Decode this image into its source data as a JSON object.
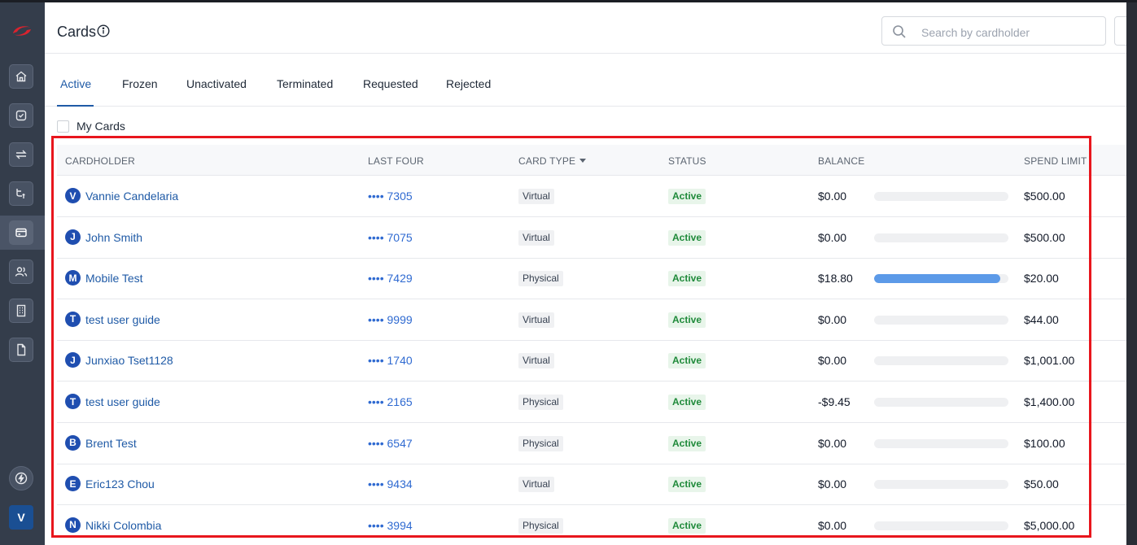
{
  "app": {
    "title": "Cards",
    "avatar_initial": "V",
    "colors": {
      "accent": "#1f5aa6",
      "highlight": "#e8161d",
      "active_green": "#1f8a3a",
      "bar_fill": "#5c9ae8"
    }
  },
  "sidebar": {
    "items": [
      {
        "name": "home-icon"
      },
      {
        "name": "tasks-icon"
      },
      {
        "name": "transfers-icon"
      },
      {
        "name": "routing-icon"
      },
      {
        "name": "cards-icon",
        "selected": true
      },
      {
        "name": "people-icon"
      },
      {
        "name": "building-icon"
      },
      {
        "name": "document-icon"
      }
    ],
    "bottom": [
      {
        "name": "lightning-icon"
      }
    ]
  },
  "search": {
    "placeholder": "Search by cardholder"
  },
  "tabs": [
    "Active",
    "Frozen",
    "Unactivated",
    "Terminated",
    "Requested",
    "Rejected"
  ],
  "active_tab": "Active",
  "filter": {
    "my_cards_label": "My Cards",
    "checked": false
  },
  "table": {
    "headers": {
      "cardholder": "CARDHOLDER",
      "last_four": "LAST FOUR",
      "card_type": "CARD TYPE",
      "status": "STATUS",
      "balance": "BALANCE",
      "spend_limit": "SPEND LIMIT"
    },
    "rows": [
      {
        "initial": "V",
        "name": "Vannie Candelaria",
        "last4": "•••• 7305",
        "type": "Virtual",
        "status": "Active",
        "balance": "$0.00",
        "progress": 0,
        "limit": "$500.00"
      },
      {
        "initial": "J",
        "name": "John Smith",
        "last4": "•••• 7075",
        "type": "Virtual",
        "status": "Active",
        "balance": "$0.00",
        "progress": 0,
        "limit": "$500.00"
      },
      {
        "initial": "M",
        "name": "Mobile Test",
        "last4": "•••• 7429",
        "type": "Physical",
        "status": "Active",
        "balance": "$18.80",
        "progress": 0.94,
        "limit": "$20.00"
      },
      {
        "initial": "T",
        "name": "test user guide",
        "last4": "•••• 9999",
        "type": "Virtual",
        "status": "Active",
        "balance": "$0.00",
        "progress": 0,
        "limit": "$44.00"
      },
      {
        "initial": "J",
        "name": "Junxiao Tset1128",
        "last4": "•••• 1740",
        "type": "Virtual",
        "status": "Active",
        "balance": "$0.00",
        "progress": 0,
        "limit": "$1,001.00"
      },
      {
        "initial": "T",
        "name": "test user guide",
        "last4": "•••• 2165",
        "type": "Physical",
        "status": "Active",
        "balance": "-$9.45",
        "progress": 0,
        "limit": "$1,400.00"
      },
      {
        "initial": "B",
        "name": "Brent Test",
        "last4": "•••• 6547",
        "type": "Physical",
        "status": "Active",
        "balance": "$0.00",
        "progress": 0,
        "limit": "$100.00"
      },
      {
        "initial": "E",
        "name": "Eric123 Chou",
        "last4": "•••• 9434",
        "type": "Virtual",
        "status": "Active",
        "balance": "$0.00",
        "progress": 0,
        "limit": "$50.00"
      },
      {
        "initial": "N",
        "name": "Nikki Colombia",
        "last4": "•••• 3994",
        "type": "Physical",
        "status": "Active",
        "balance": "$0.00",
        "progress": 0,
        "limit": "$5,000.00"
      }
    ]
  }
}
